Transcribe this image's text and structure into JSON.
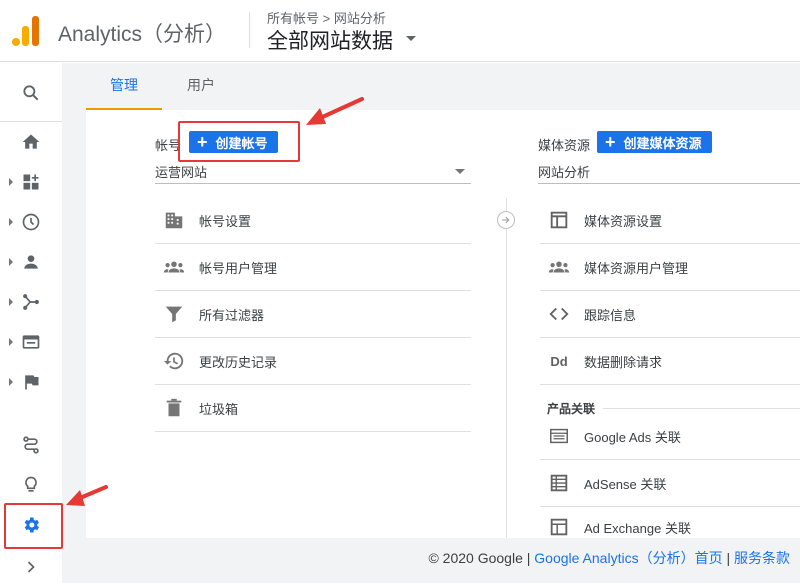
{
  "header": {
    "app_title": "Analytics（分析）",
    "breadcrumb": "所有帐号 > 网站分析",
    "view_title": "全部网站数据"
  },
  "tabs": [
    {
      "label": "管理",
      "active": true
    },
    {
      "label": "用户",
      "active": false
    }
  ],
  "account": {
    "label": "帐号",
    "create_button": "创建帐号",
    "selected": "运营网站",
    "items": [
      {
        "label": "帐号设置",
        "icon": "building-icon"
      },
      {
        "label": "帐号用户管理",
        "icon": "people-icon"
      },
      {
        "label": "所有过滤器",
        "icon": "filter-icon"
      },
      {
        "label": "更改历史记录",
        "icon": "history-icon"
      },
      {
        "label": "垃圾箱",
        "icon": "trash-icon"
      }
    ]
  },
  "property": {
    "label": "媒体资源",
    "create_button": "创建媒体资源",
    "selected": "网站分析",
    "items": [
      {
        "label": "媒体资源设置",
        "icon": "layout-icon"
      },
      {
        "label": "媒体资源用户管理",
        "icon": "people-icon"
      },
      {
        "label": "跟踪信息",
        "icon": "code-icon"
      },
      {
        "label": "数据删除请求",
        "icon": "dd-icon"
      }
    ],
    "section_title": "产品关联",
    "links": [
      {
        "label": "Google Ads 关联",
        "icon": "ads-icon"
      },
      {
        "label": "AdSense 关联",
        "icon": "adsense-icon"
      },
      {
        "label": "Ad Exchange 关联",
        "icon": "adx-icon"
      }
    ],
    "dd_glyph": "Dd"
  },
  "footer": {
    "copyright": "© 2020 Google",
    "sep": " | ",
    "home_link": "Google Analytics（分析）首页",
    "terms_link": "服务条款"
  },
  "colors": {
    "accent": "#1a73e8",
    "tab_underline": "#f29900",
    "annotation": "#e53935"
  }
}
